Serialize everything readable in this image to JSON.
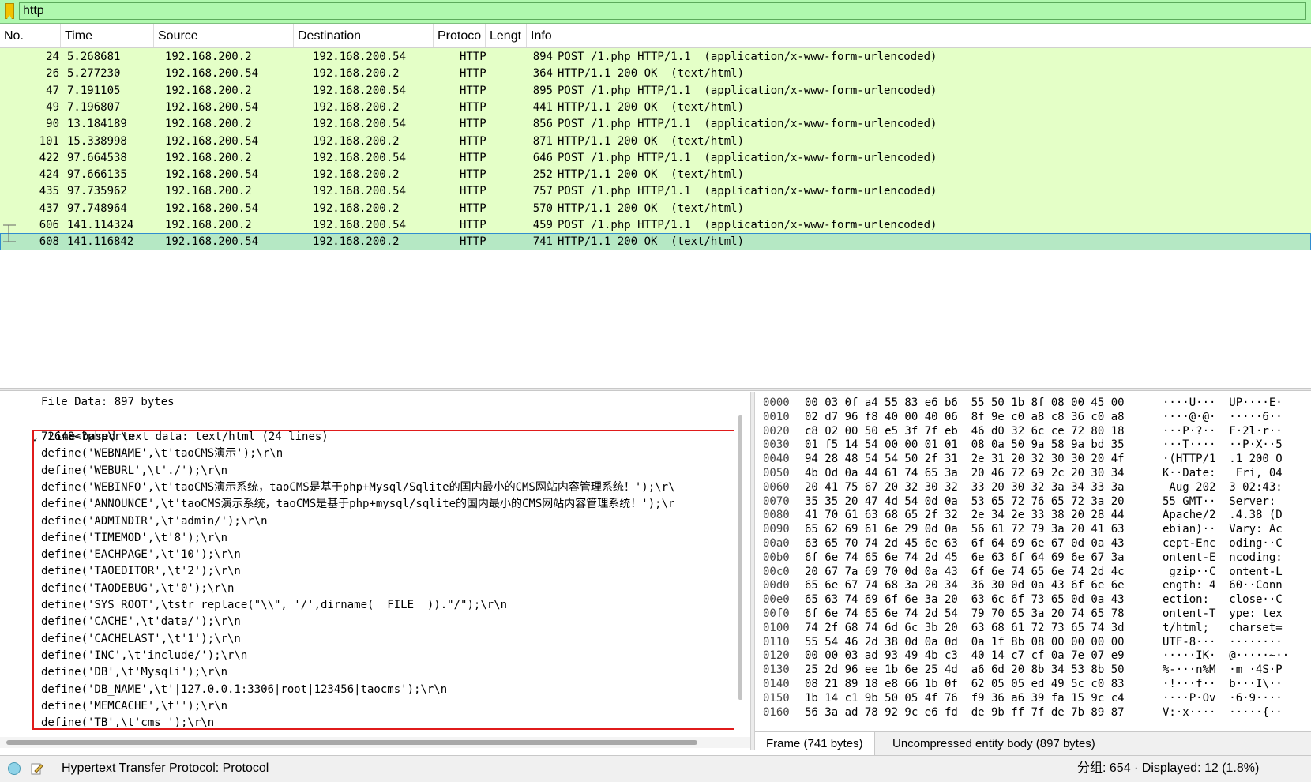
{
  "filter": {
    "value": "http"
  },
  "columns": [
    "No.",
    "Time",
    "Source",
    "Destination",
    "Protoco",
    "Lengt",
    "Info"
  ],
  "packets": [
    {
      "no": "24",
      "time": "5.268681",
      "src": "192.168.200.2",
      "dst": "192.168.200.54",
      "proto": "HTTP",
      "len": "894",
      "info": "POST /1.php HTTP/1.1  (application/x-www-form-urlencoded)"
    },
    {
      "no": "26",
      "time": "5.277230",
      "src": "192.168.200.54",
      "dst": "192.168.200.2",
      "proto": "HTTP",
      "len": "364",
      "info": "HTTP/1.1 200 OK  (text/html)"
    },
    {
      "no": "47",
      "time": "7.191105",
      "src": "192.168.200.2",
      "dst": "192.168.200.54",
      "proto": "HTTP",
      "len": "895",
      "info": "POST /1.php HTTP/1.1  (application/x-www-form-urlencoded)"
    },
    {
      "no": "49",
      "time": "7.196807",
      "src": "192.168.200.54",
      "dst": "192.168.200.2",
      "proto": "HTTP",
      "len": "441",
      "info": "HTTP/1.1 200 OK  (text/html)"
    },
    {
      "no": "90",
      "time": "13.184189",
      "src": "192.168.200.2",
      "dst": "192.168.200.54",
      "proto": "HTTP",
      "len": "856",
      "info": "POST /1.php HTTP/1.1  (application/x-www-form-urlencoded)"
    },
    {
      "no": "101",
      "time": "15.338998",
      "src": "192.168.200.54",
      "dst": "192.168.200.2",
      "proto": "HTTP",
      "len": "871",
      "info": "HTTP/1.1 200 OK  (text/html)"
    },
    {
      "no": "422",
      "time": "97.664538",
      "src": "192.168.200.2",
      "dst": "192.168.200.54",
      "proto": "HTTP",
      "len": "646",
      "info": "POST /1.php HTTP/1.1  (application/x-www-form-urlencoded)"
    },
    {
      "no": "424",
      "time": "97.666135",
      "src": "192.168.200.54",
      "dst": "192.168.200.2",
      "proto": "HTTP",
      "len": "252",
      "info": "HTTP/1.1 200 OK  (text/html)"
    },
    {
      "no": "435",
      "time": "97.735962",
      "src": "192.168.200.2",
      "dst": "192.168.200.54",
      "proto": "HTTP",
      "len": "757",
      "info": "POST /1.php HTTP/1.1  (application/x-www-form-urlencoded)"
    },
    {
      "no": "437",
      "time": "97.748964",
      "src": "192.168.200.54",
      "dst": "192.168.200.2",
      "proto": "HTTP",
      "len": "570",
      "info": "HTTP/1.1 200 OK  (text/html)"
    },
    {
      "no": "606",
      "time": "141.114324",
      "src": "192.168.200.2",
      "dst": "192.168.200.54",
      "proto": "HTTP",
      "len": "459",
      "info": "POST /1.php HTTP/1.1  (application/x-www-form-urlencoded)"
    },
    {
      "no": "608",
      "time": "141.116842",
      "src": "192.168.200.54",
      "dst": "192.168.200.2",
      "proto": "HTTP",
      "len": "741",
      "info": "HTTP/1.1 200 OK  (text/html)"
    }
  ],
  "selected_packet_index": 11,
  "details": {
    "file_data": "File Data: 897 bytes",
    "line_based": "Line-based text data: text/html (24 lines)",
    "lines": [
      "72648<?php\\r\\n",
      "define('WEBNAME',\\t'taoCMS演示');\\r\\n",
      "define('WEBURL',\\t'./');\\r\\n",
      "define('WEBINFO',\\t'taoCMS演示系统，taoCMS是基于php+Mysql/Sqlite的国内最小的CMS网站内容管理系统！');\\r\\",
      "define('ANNOUNCE',\\t'taoCMS演示系统，taoCMS是基于php+mysql/sqlite的国内最小的CMS网站内容管理系统！');\\r",
      "define('ADMINDIR',\\t'admin/');\\r\\n",
      "define('TIMEMOD',\\t'8');\\r\\n",
      "define('EACHPAGE',\\t'10');\\r\\n",
      "define('TAOEDITOR',\\t'2');\\r\\n",
      "define('TAODEBUG',\\t'0');\\r\\n",
      "define('SYS_ROOT',\\tstr_replace(\"\\\\\", '/',dirname(__FILE__)).\"/\");\\r\\n",
      "define('CACHE',\\t'data/');\\r\\n",
      "define('CACHELAST',\\t'1');\\r\\n",
      "define('INC',\\t'include/');\\r\\n",
      "define('DB',\\t'Mysqli');\\r\\n",
      "define('DB_NAME',\\t'|127.0.0.1:3306|root|123456|taocms');\\r\\n",
      "define('MEMCACHE',\\t'');\\r\\n",
      "define('TB',\\t'cms_');\\r\\n"
    ]
  },
  "bytes": [
    {
      "off": "0000",
      "hex": "00 03 0f a4 55 83 e6 b6  55 50 1b 8f 08 00 45 00",
      "ascii": "····U···  UP····E·"
    },
    {
      "off": "0010",
      "hex": "02 d7 96 f8 40 00 40 06  8f 9e c0 a8 c8 36 c0 a8",
      "ascii": "····@·@·  ·····6··"
    },
    {
      "off": "0020",
      "hex": "c8 02 00 50 e5 3f 7f eb  46 d0 32 6c ce 72 80 18",
      "ascii": "···P·?··  F·2l·r··"
    },
    {
      "off": "0030",
      "hex": "01 f5 14 54 00 00 01 01  08 0a 50 9a 58 9a bd 35",
      "ascii": "···T····  ··P·X··5"
    },
    {
      "off": "0040",
      "hex": "94 28 48 54 54 50 2f 31  2e 31 20 32 30 30 20 4f",
      "ascii": "·(HTTP/1  .1 200 O"
    },
    {
      "off": "0050",
      "hex": "4b 0d 0a 44 61 74 65 3a  20 46 72 69 2c 20 30 34",
      "ascii": "K··Date:   Fri, 04"
    },
    {
      "off": "0060",
      "hex": "20 41 75 67 20 32 30 32  33 20 30 32 3a 34 33 3a",
      "ascii": " Aug 202  3 02:43:"
    },
    {
      "off": "0070",
      "hex": "35 35 20 47 4d 54 0d 0a  53 65 72 76 65 72 3a 20",
      "ascii": "55 GMT··  Server: "
    },
    {
      "off": "0080",
      "hex": "41 70 61 63 68 65 2f 32  2e 34 2e 33 38 20 28 44",
      "ascii": "Apache/2  .4.38 (D"
    },
    {
      "off": "0090",
      "hex": "65 62 69 61 6e 29 0d 0a  56 61 72 79 3a 20 41 63",
      "ascii": "ebian)··  Vary: Ac"
    },
    {
      "off": "00a0",
      "hex": "63 65 70 74 2d 45 6e 63  6f 64 69 6e 67 0d 0a 43",
      "ascii": "cept-Enc  oding··C"
    },
    {
      "off": "00b0",
      "hex": "6f 6e 74 65 6e 74 2d 45  6e 63 6f 64 69 6e 67 3a",
      "ascii": "ontent-E  ncoding:"
    },
    {
      "off": "00c0",
      "hex": "20 67 7a 69 70 0d 0a 43  6f 6e 74 65 6e 74 2d 4c",
      "ascii": " gzip··C  ontent-L"
    },
    {
      "off": "00d0",
      "hex": "65 6e 67 74 68 3a 20 34  36 30 0d 0a 43 6f 6e 6e",
      "ascii": "ength: 4  60··Conn"
    },
    {
      "off": "00e0",
      "hex": "65 63 74 69 6f 6e 3a 20  63 6c 6f 73 65 0d 0a 43",
      "ascii": "ection:   close··C"
    },
    {
      "off": "00f0",
      "hex": "6f 6e 74 65 6e 74 2d 54  79 70 65 3a 20 74 65 78",
      "ascii": "ontent-T  ype: tex"
    },
    {
      "off": "0100",
      "hex": "74 2f 68 74 6d 6c 3b 20  63 68 61 72 73 65 74 3d",
      "ascii": "t/html;   charset="
    },
    {
      "off": "0110",
      "hex": "55 54 46 2d 38 0d 0a 0d  0a 1f 8b 08 00 00 00 00",
      "ascii": "UTF-8···  ········"
    },
    {
      "off": "0120",
      "hex": "00 00 03 ad 93 49 4b c3  40 14 c7 cf 0a 7e 07 e9",
      "ascii": "·····IK·  @·····~··"
    },
    {
      "off": "0130",
      "hex": "25 2d 96 ee 1b 6e 25 4d  a6 6d 20 8b 34 53 8b 50",
      "ascii": "%-···n%M  ·m ·4S·P"
    },
    {
      "off": "0140",
      "hex": "08 21 89 18 e8 66 1b 0f  62 05 05 ed 49 5c c0 83",
      "ascii": "·!···f··  b···I\\··"
    },
    {
      "off": "0150",
      "hex": "1b 14 c1 9b 50 05 4f 76  f9 36 a6 39 fa 15 9c c4",
      "ascii": "····P·Ov  ·6·9····"
    },
    {
      "off": "0160",
      "hex": "56 3a ad 78 92 9c e6 fd  de 9b ff 7f de 7b 89 87",
      "ascii": "V:·x····  ·····{··"
    }
  ],
  "bytes_tabs": [
    "Frame (741 bytes)",
    "Uncompressed entity body (897 bytes)"
  ],
  "status": {
    "protocol": "Hypertext Transfer Protocol: Protocol",
    "counts": "分组: 654 · Displayed: 12 (1.8%)"
  }
}
